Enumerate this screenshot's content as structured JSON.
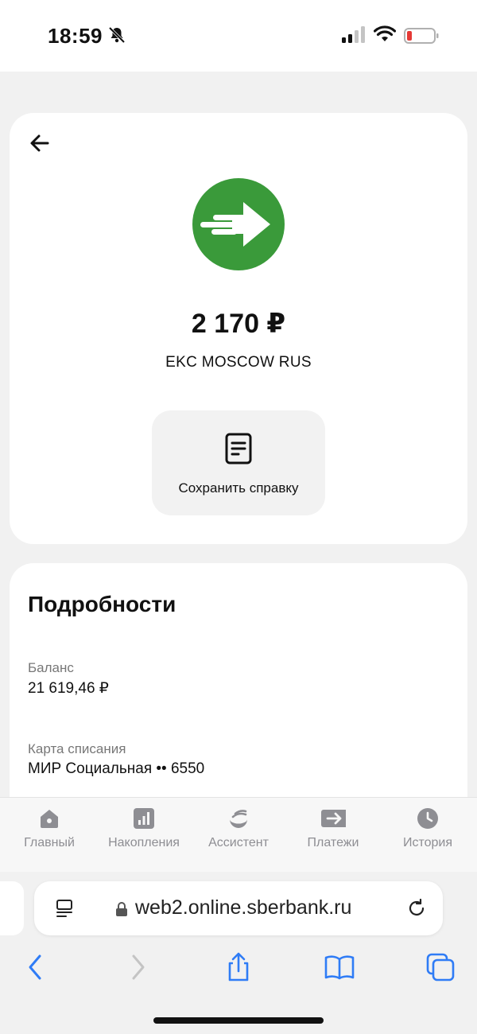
{
  "status_bar": {
    "time": "18:59",
    "icons": [
      "bell-slash-icon",
      "signal-icon",
      "wifi-icon",
      "battery-low-icon"
    ]
  },
  "transaction": {
    "amount": "2 170 ₽",
    "merchant": "EKC MOSCOW RUS",
    "logo_color": "#3a9a3a",
    "save_certificate_label": "Сохранить справку"
  },
  "details": {
    "title": "Подробности",
    "fields": [
      {
        "label": "Баланс",
        "value": "21 619,46 ₽"
      },
      {
        "label": "Карта списания",
        "value": "МИР Социальная •• 6550"
      }
    ]
  },
  "tabbar": {
    "tabs": [
      {
        "label": "Главный",
        "icon": "home-icon"
      },
      {
        "label": "Накопления",
        "icon": "chart-icon"
      },
      {
        "label": "Ассистент",
        "icon": "assistant-icon"
      },
      {
        "label": "Платежи",
        "icon": "payments-icon"
      },
      {
        "label": "История",
        "icon": "clock-icon"
      }
    ]
  },
  "browser": {
    "url": "web2.online.sberbank.ru",
    "accent": "#2f7cf6"
  }
}
